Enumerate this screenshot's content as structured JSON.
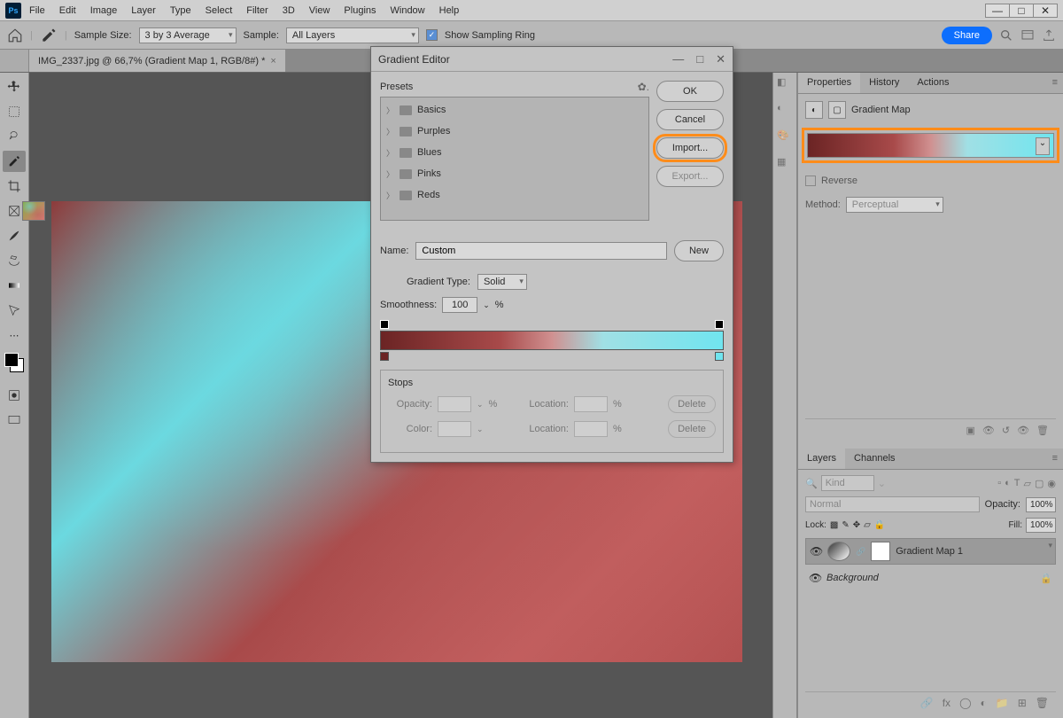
{
  "menu": [
    "File",
    "Edit",
    "Image",
    "Layer",
    "Type",
    "Select",
    "Filter",
    "3D",
    "View",
    "Plugins",
    "Window",
    "Help"
  ],
  "options": {
    "sampleSizeLabel": "Sample Size:",
    "sampleSizeValue": "3 by 3 Average",
    "sampleLabel": "Sample:",
    "sampleValue": "All Layers",
    "showRing": "Show Sampling Ring",
    "share": "Share"
  },
  "tab": {
    "title": "IMG_2337.jpg @ 66,7% (Gradient Map 1, RGB/8#) *"
  },
  "dialog": {
    "title": "Gradient Editor",
    "presetsLabel": "Presets",
    "presets": [
      "Basics",
      "Purples",
      "Blues",
      "Pinks",
      "Reds"
    ],
    "btnOK": "OK",
    "btnCancel": "Cancel",
    "btnImport": "Import...",
    "btnExport": "Export...",
    "btnNew": "New",
    "nameLabel": "Name:",
    "nameValue": "Custom",
    "gradTypeLabel": "Gradient Type:",
    "gradTypeValue": "Solid",
    "smoothLabel": "Smoothness:",
    "smoothValue": "100",
    "stopsLabel": "Stops",
    "opacityLabel": "Opacity:",
    "locationLabel": "Location:",
    "colorLabel": "Color:",
    "deleteLabel": "Delete"
  },
  "properties": {
    "tabProperties": "Properties",
    "tabHistory": "History",
    "tabActions": "Actions",
    "title": "Gradient Map",
    "reverse": "Reverse",
    "methodLabel": "Method:",
    "methodValue": "Perceptual"
  },
  "layers": {
    "tabLayers": "Layers",
    "tabChannels": "Channels",
    "kind": "Kind",
    "blend": "Normal",
    "opacityLabel": "Opacity:",
    "opacityValue": "100%",
    "lockLabel": "Lock:",
    "fillLabel": "Fill:",
    "fillValue": "100%",
    "layer1": "Gradient Map 1",
    "layer2": "Background"
  }
}
